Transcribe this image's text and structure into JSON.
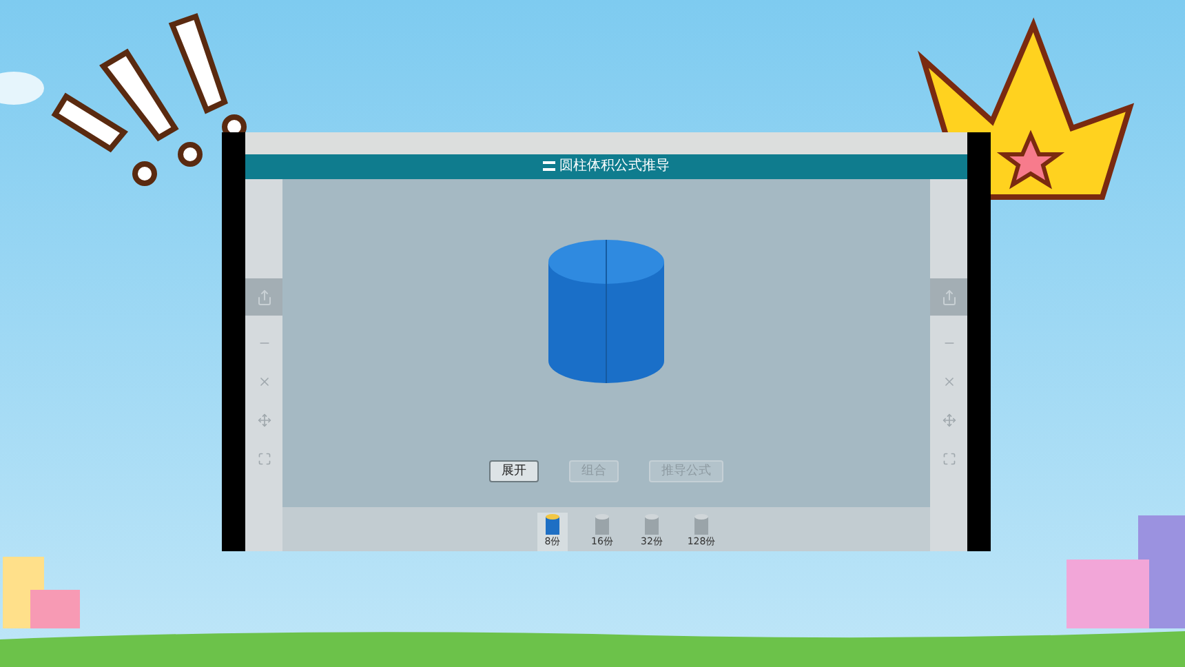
{
  "title": "圆柱体积公式推导",
  "buttons": [
    {
      "label": "展开",
      "disabled": false
    },
    {
      "label": "组合",
      "disabled": true
    },
    {
      "label": "推导公式",
      "disabled": true
    }
  ],
  "slices": [
    {
      "label": "8份",
      "selected": true
    },
    {
      "label": "16份",
      "selected": false
    },
    {
      "label": "32份",
      "selected": false
    },
    {
      "label": "128份",
      "selected": false
    }
  ]
}
